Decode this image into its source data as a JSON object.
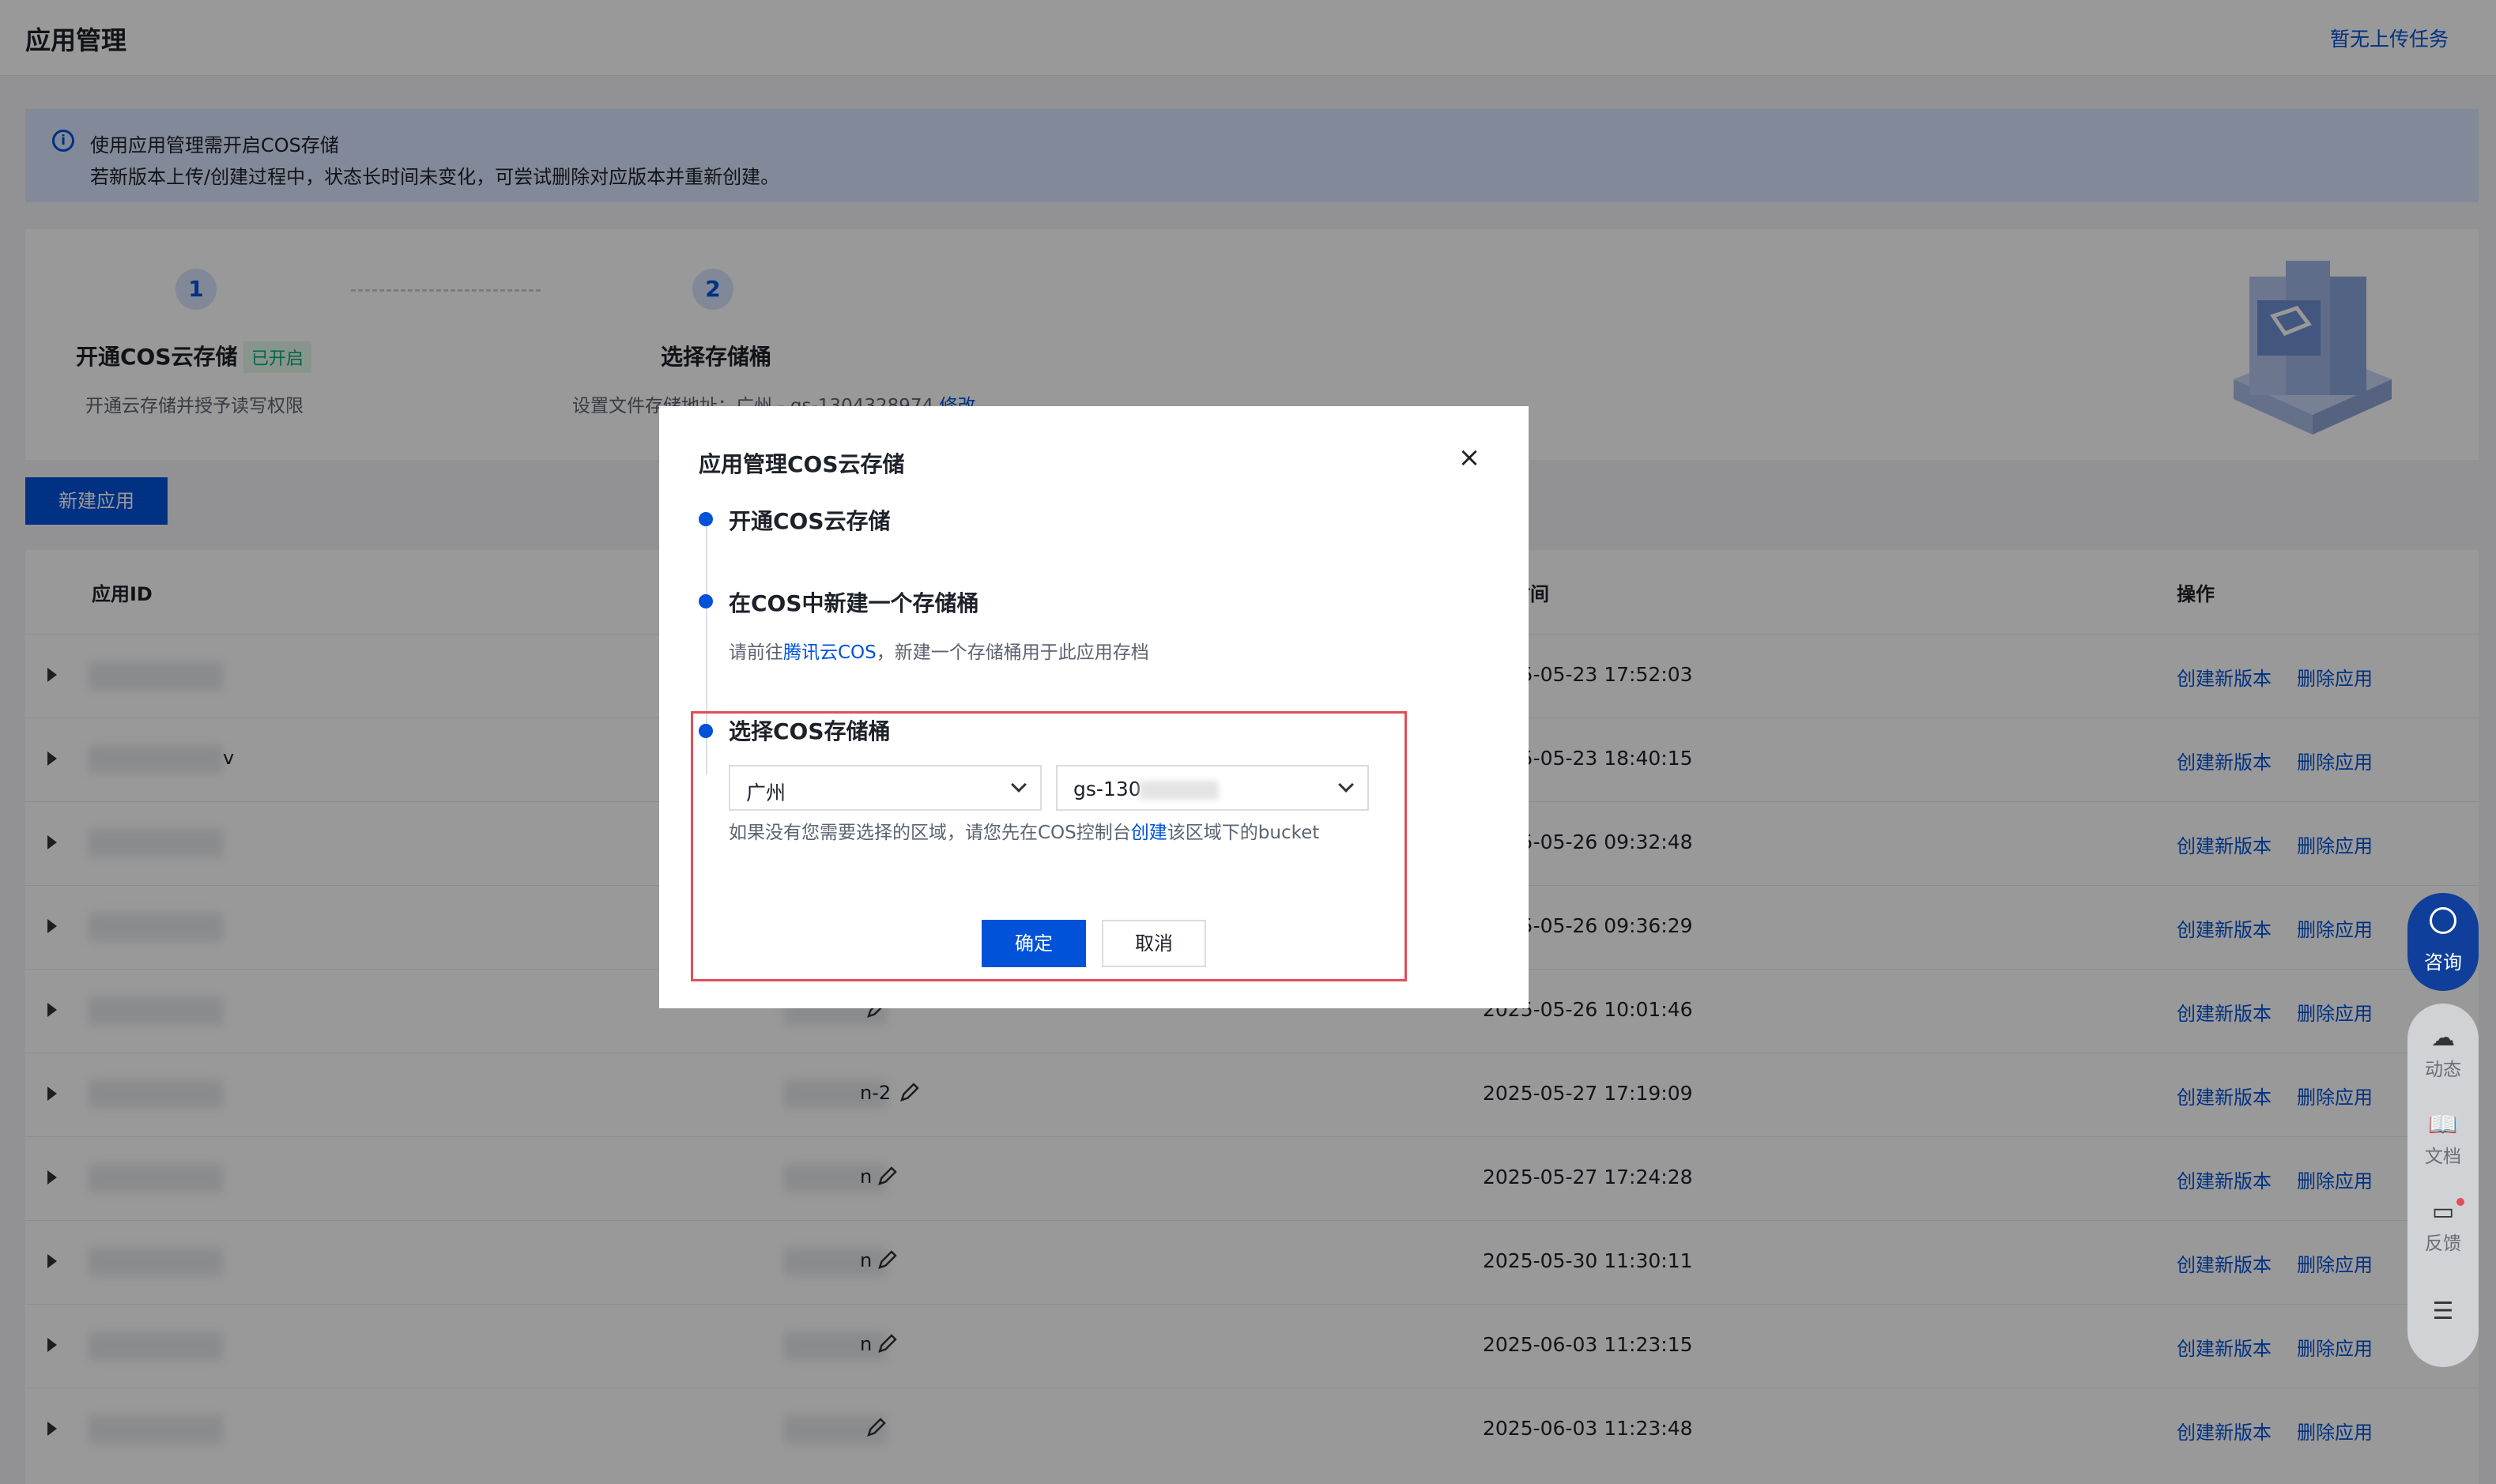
{
  "header": {
    "title": "应用管理",
    "upload_status": "暂无上传任务"
  },
  "notice": {
    "line1": "使用应用管理需开启COS存储",
    "line2": "若新版本上传/创建过程中，状态长时间未变化，可尝试删除对应版本并重新创建。"
  },
  "steps": [
    {
      "num": "1",
      "title": "开通COS云存储",
      "badge": "已开启",
      "desc": "开通云存储并授予读写权限"
    },
    {
      "num": "2",
      "title": "选择存储桶",
      "desc": "设置文件存储地址：广州 - gs-1304328974",
      "link": "修改"
    }
  ],
  "toolbar": {
    "new_app": "新建应用"
  },
  "table": {
    "headers": {
      "app_id": "应用ID",
      "time": "时间",
      "actions": "操作"
    },
    "action_create": "创建新版本",
    "action_delete": "删除应用",
    "rows": [
      {
        "id_tail": "",
        "name_tail": "",
        "time": "2025-05-23 17:52:03"
      },
      {
        "id_tail": "v",
        "name_tail": "",
        "time": "2025-05-23 18:40:15"
      },
      {
        "id_tail": "",
        "name_tail": "",
        "time": "2025-05-26 09:32:48"
      },
      {
        "id_tail": "",
        "name_tail": "",
        "time": "2025-05-26 09:36:29"
      },
      {
        "id_tail": "",
        "name_tail": "",
        "time": "2025-05-26 10:01:46"
      },
      {
        "id_tail": "",
        "name_tail": "n-2",
        "time": "2025-05-27 17:19:09"
      },
      {
        "id_tail": "",
        "name_tail": "n",
        "time": "2025-05-27 17:24:28"
      },
      {
        "id_tail": "",
        "name_tail": "n",
        "time": "2025-05-30 11:30:11"
      },
      {
        "id_tail": "",
        "name_tail": "n",
        "time": "2025-06-03 11:23:15"
      },
      {
        "id_tail": "",
        "name_tail": "",
        "time": "2025-06-03 11:23:48"
      }
    ]
  },
  "float_sidebar": {
    "consult": "咨询",
    "items": [
      {
        "label": "动态"
      },
      {
        "label": "文档"
      },
      {
        "label": "反馈"
      }
    ]
  },
  "modal": {
    "title": "应用管理COS云存储",
    "step1": "开通COS云存储",
    "step2": "在COS中新建一个存储桶",
    "step2_desc_pre": "请前往",
    "step2_link": "腾讯云COS",
    "step2_desc_post": "，新建一个存储桶用于此应用存档",
    "step3": "选择COS存储桶",
    "region_value": "广州",
    "bucket_value": "gs-130",
    "hint_pre": "如果没有您需要选择的区域，请您先在COS控制台",
    "hint_link": "创建",
    "hint_post": "该区域下的bucket",
    "ok": "确定",
    "cancel": "取消"
  },
  "colors": {
    "primary": "#0052d9",
    "highlight_box": "#e34d59",
    "enabled_badge": "#00a870"
  }
}
